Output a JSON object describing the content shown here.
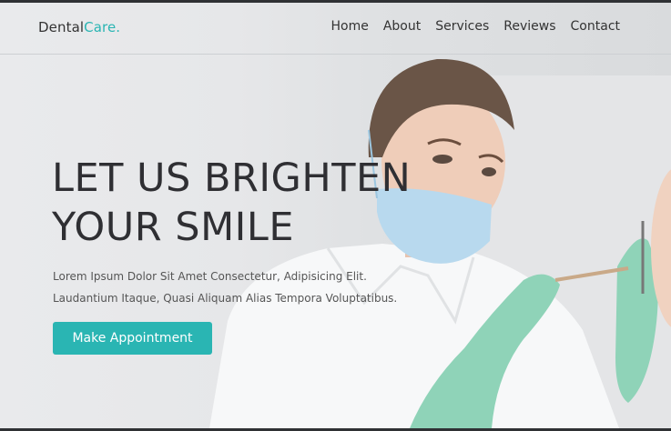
{
  "brand": {
    "name": "Dental",
    "accent_part": "Care.",
    "accent_color": "#2ab5b3"
  },
  "nav": {
    "items": [
      "Home",
      "About",
      "Services",
      "Reviews",
      "Contact"
    ]
  },
  "hero": {
    "title_line1": "LET US BRIGHTEN",
    "title_line2": "YOUR SMILE",
    "desc_line1": "Lorem Ipsum Dolor Sit Amet Consectetur, Adipisicing Elit.",
    "desc_line2": "Laudantium Itaque, Quasi Aliquam Alias Tempora Voluptatibus.",
    "cta_label": "Make Appointment"
  }
}
